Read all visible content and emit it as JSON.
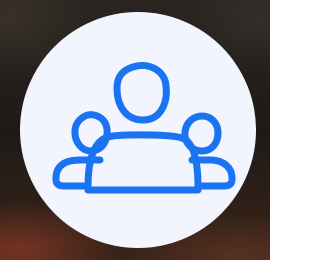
{
  "avatar": {
    "icon": "people-group-icon",
    "background_color": "#f2f5fd",
    "icon_color": "#1a73f0"
  }
}
